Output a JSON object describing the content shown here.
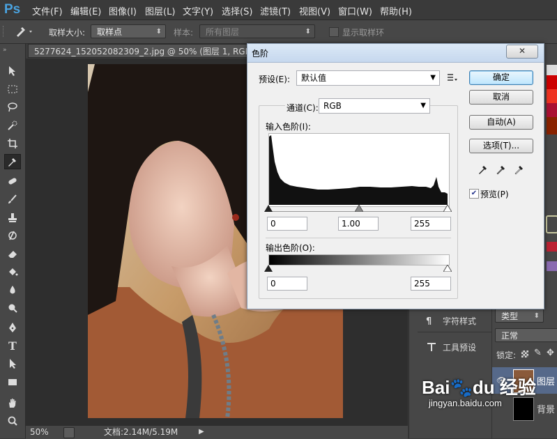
{
  "app": {
    "logo": "Ps"
  },
  "menu": [
    "文件(F)",
    "编辑(E)",
    "图像(I)",
    "图层(L)",
    "文字(Y)",
    "选择(S)",
    "滤镜(T)",
    "视图(V)",
    "窗口(W)",
    "帮助(H)"
  ],
  "options_bar": {
    "sample_size_label": "取样大小:",
    "sample_size_value": "取样点",
    "sample_label": "样本:",
    "sample_value": "所有图层",
    "show_ring_label": "显示取样环"
  },
  "document": {
    "tab_title": "5277624_152052082309_2.jpg @ 50% (图层 1, RGB/8#)",
    "zoom": "50%",
    "doc_size": "文档:2.14M/5.19M"
  },
  "dialog": {
    "title": "色阶",
    "preset_label": "预设(E):",
    "preset_value": "默认值",
    "channel_label": "通道(C):",
    "channel_value": "RGB",
    "input_levels_label": "输入色阶(I):",
    "input_black": "0",
    "input_gamma": "1.00",
    "input_white": "255",
    "output_levels_label": "输出色阶(O):",
    "output_black": "0",
    "output_white": "255",
    "ok_label": "确定",
    "cancel_label": "取消",
    "auto_label": "自动(A)",
    "options_label": "选项(T)...",
    "preview_label": "预览(P)",
    "preview_checked": true
  },
  "panels": {
    "char_style_label": "字符样式",
    "tool_preset_label": "工具预设",
    "layers_kind": "类型",
    "blend_mode": "正常",
    "lock_label": "锁定:",
    "layer1_name": "图层",
    "layer2_name": "背景"
  },
  "watermark": {
    "brand": "Bai",
    "brand2": "du",
    "brand3": "经验",
    "url": "jingyan.baidu.com"
  }
}
